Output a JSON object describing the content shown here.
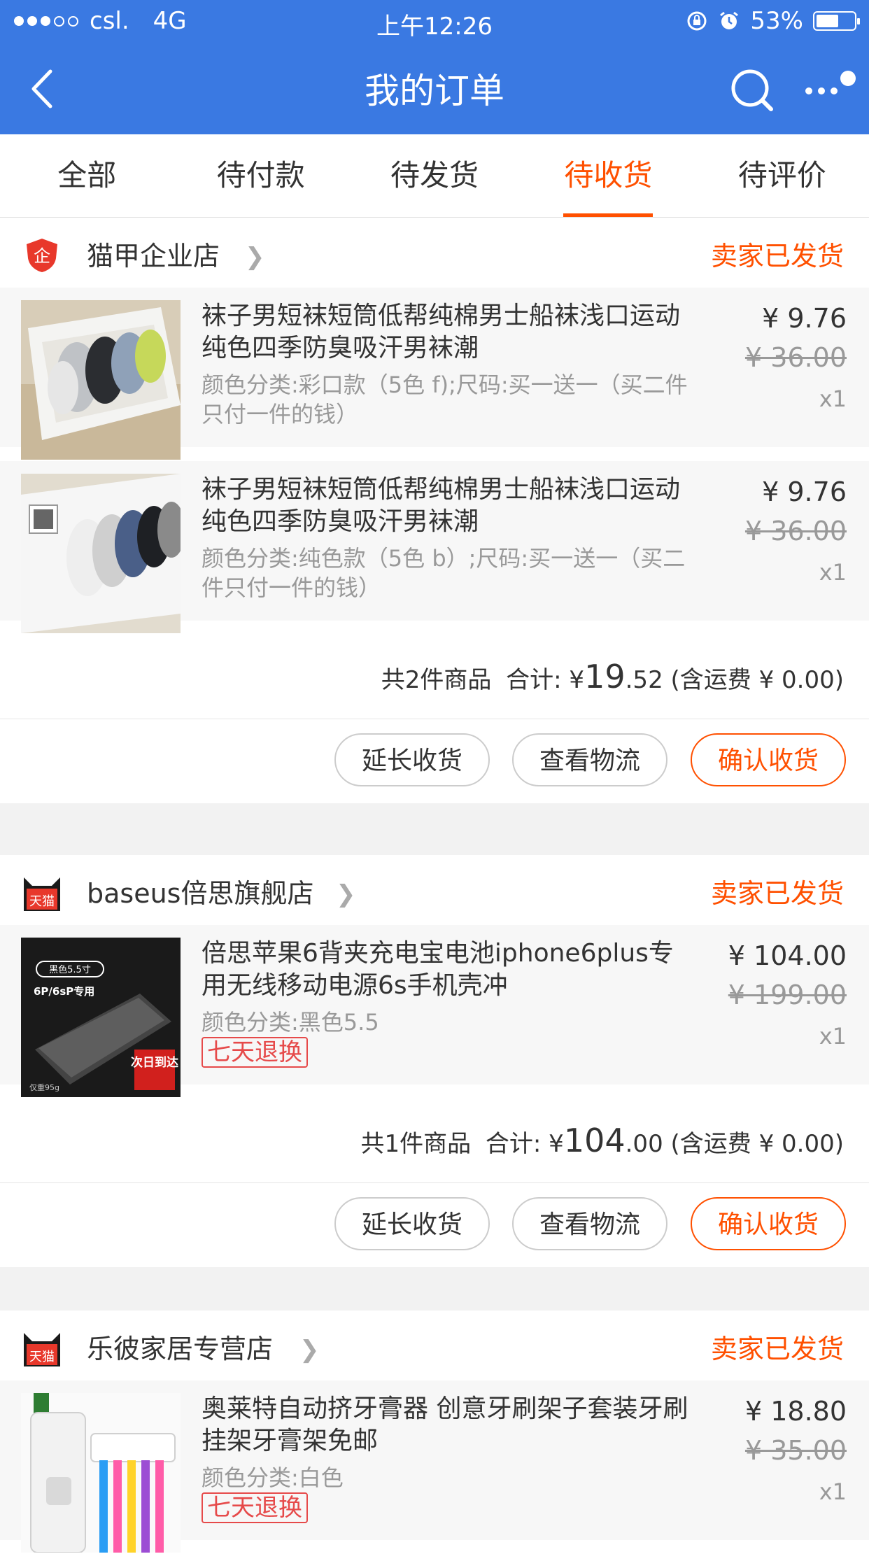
{
  "status": {
    "carrier": "csl.",
    "network": "4G",
    "time": "上午12:26",
    "battery": "53%"
  },
  "nav": {
    "title": "我的订单"
  },
  "tabs": [
    "全部",
    "待付款",
    "待发货",
    "待收货",
    "待评价"
  ],
  "orders": [
    {
      "shop": "猫甲企业店",
      "status": "卖家已发货",
      "items": [
        {
          "title": "袜子男短袜短筒低帮纯棉男士船袜浅口运动纯色四季防臭吸汗男袜潮",
          "sku": "颜色分类:彩口款（5色 f);尺码:买一送一（买二件只付一件的钱）",
          "price": "¥ 9.76",
          "oprice": "¥ 36.00",
          "qty": "x1"
        },
        {
          "title": "袜子男短袜短筒低帮纯棉男士船袜浅口运动纯色四季防臭吸汗男袜潮",
          "sku": "颜色分类:纯色款（5色 b）;尺码:买一送一（买二件只付一件的钱）",
          "price": "¥ 9.76",
          "oprice": "¥ 36.00",
          "qty": "x1"
        }
      ],
      "summary": {
        "count": "共2件商品",
        "label": "合计: ¥",
        "int": "19",
        "dec": ".52",
        "ship": "(含运费 ¥ 0.00)"
      },
      "buttons": [
        "延长收货",
        "查看物流",
        "确认收货"
      ]
    },
    {
      "shop": "baseus倍思旗舰店",
      "status": "卖家已发货",
      "items": [
        {
          "title": "倍思苹果6背夹充电宝电池iphone6plus专用无线移动电源6s手机壳冲",
          "sku": "颜色分类:黑色5.5",
          "tag": "七天退换",
          "price": "¥ 104.00",
          "oprice": "¥ 199.00",
          "qty": "x1",
          "img_text": {
            "badge": "黑色5.5寸",
            "model": "6P/6sP专用",
            "weight": "仅重95g",
            "delivery": "次日到达"
          }
        }
      ],
      "summary": {
        "count": "共1件商品",
        "label": "合计: ¥",
        "int": "104",
        "dec": ".00",
        "ship": "(含运费 ¥ 0.00)"
      },
      "buttons": [
        "延长收货",
        "查看物流",
        "确认收货"
      ]
    },
    {
      "shop": "乐彼家居专营店",
      "status": "卖家已发货",
      "items": [
        {
          "title": "奥莱特自动挤牙膏器 创意牙刷架子套装牙刷挂架牙膏架免邮",
          "sku": "颜色分类:白色",
          "tag": "七天退换",
          "price": "¥ 18.80",
          "oprice": "¥ 35.00",
          "qty": "x1"
        }
      ]
    }
  ],
  "shop_icons": {
    "qiye": "企",
    "tmall": "天猫"
  },
  "colors": {
    "brand": "#3a79e2",
    "accent": "#ff5000"
  }
}
